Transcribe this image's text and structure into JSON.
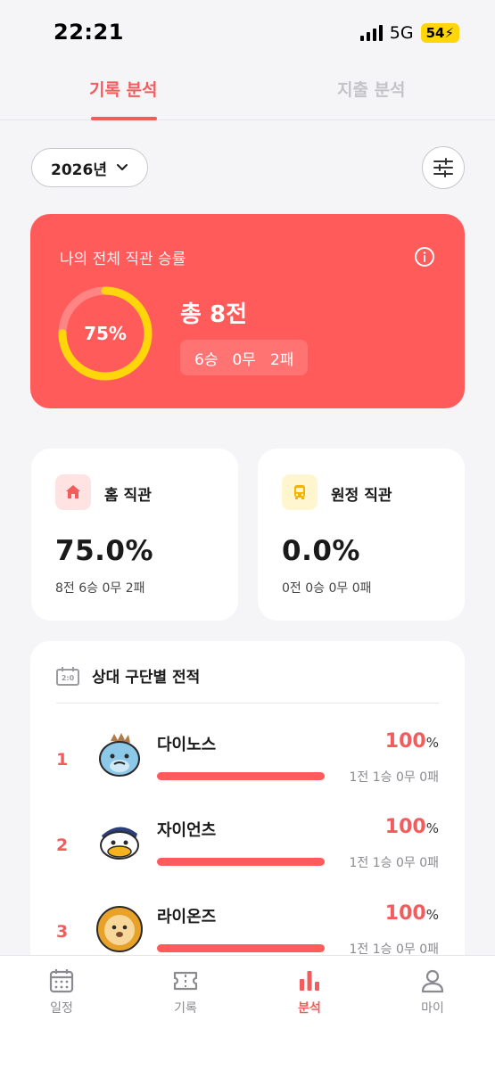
{
  "status_bar": {
    "time": "22:21",
    "network": "5G",
    "battery": "54"
  },
  "tabs": [
    {
      "label": "기록 분석",
      "active": true
    },
    {
      "label": "지출 분석",
      "active": false
    }
  ],
  "filter": {
    "year": "2026년",
    "icon": "sliders-icon"
  },
  "summary": {
    "title": "나의 전체 직관 승률",
    "win_rate_label": "75%",
    "win_rate_value": 0.75,
    "total": "총 8전",
    "wins": "6승",
    "draws": "0무",
    "losses": "2패",
    "colors": {
      "card": "#ff5b5b",
      "ring": "#ffd60a"
    }
  },
  "home": {
    "label": "홈 직관",
    "rate": "75.0%",
    "record": "8전 6승 0무 2패",
    "icon": "house-icon"
  },
  "away": {
    "label": "원정 직관",
    "rate": "0.0%",
    "record": "0전 0승 0무 0패",
    "icon": "bus-icon"
  },
  "opponents": {
    "title": "상대 구단별 전적",
    "icon": "scoreboard-icon",
    "items": [
      {
        "rank": "1",
        "name": "다이노스",
        "pct": "100",
        "unit": "%",
        "fill": 1.0,
        "record": "1전 1승 0무 0패",
        "avatar": "dinosaur-mascot-icon"
      },
      {
        "rank": "2",
        "name": "자이언츠",
        "pct": "100",
        "unit": "%",
        "fill": 1.0,
        "record": "1전 1승 0무 0패",
        "avatar": "seagull-mascot-icon"
      },
      {
        "rank": "3",
        "name": "라이온즈",
        "pct": "100",
        "unit": "%",
        "fill": 1.0,
        "record": "1전 1승 0무 0패",
        "avatar": "lion-mascot-icon"
      }
    ]
  },
  "bottom_nav": [
    {
      "label": "일정",
      "icon": "calendar-icon",
      "active": false
    },
    {
      "label": "기록",
      "icon": "ticket-icon",
      "active": false
    },
    {
      "label": "분석",
      "icon": "bar-chart-icon",
      "active": true
    },
    {
      "label": "마이",
      "icon": "person-icon",
      "active": false
    }
  ]
}
